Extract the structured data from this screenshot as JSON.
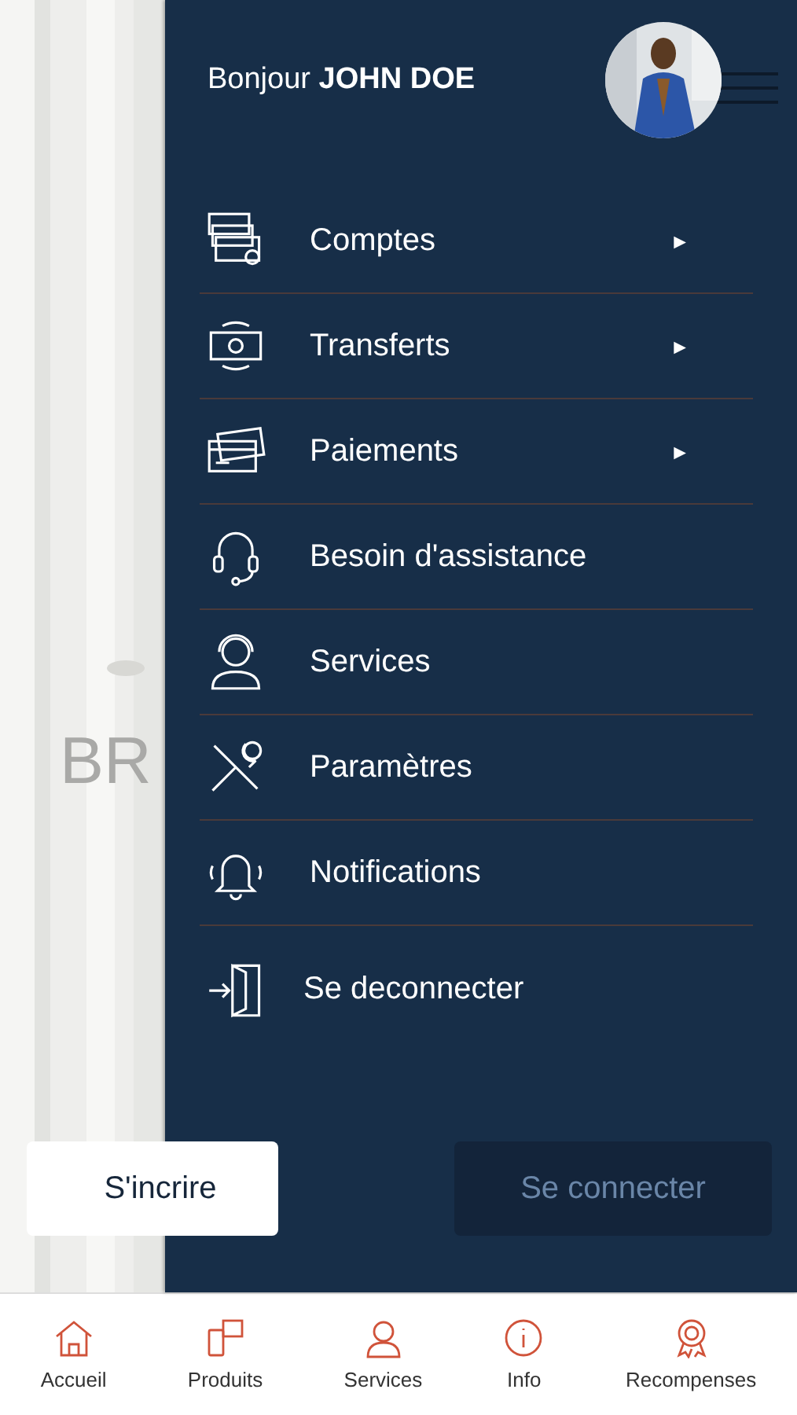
{
  "background": {
    "logo_text": "BR",
    "signup_button": "S'incrire",
    "login_button": "Se connecter"
  },
  "drawer": {
    "greeting": "Bonjour",
    "user_name": "JOHN DOE",
    "items": [
      {
        "label": "Comptes",
        "has_submenu": true
      },
      {
        "label": "Transferts",
        "has_submenu": true
      },
      {
        "label": "Paiements",
        "has_submenu": true
      },
      {
        "label": "Besoin d'assistance",
        "has_submenu": false
      },
      {
        "label": "Services",
        "has_submenu": false
      },
      {
        "label": "Paramètres",
        "has_submenu": false
      },
      {
        "label": "Notifications",
        "has_submenu": false
      }
    ],
    "submenu_arrow": "►",
    "logout": "Se deconnecter"
  },
  "bottom_nav": [
    {
      "label": "Accueil"
    },
    {
      "label": "Produits"
    },
    {
      "label": "Services"
    },
    {
      "label": "Info"
    },
    {
      "label": "Recompenses"
    }
  ]
}
